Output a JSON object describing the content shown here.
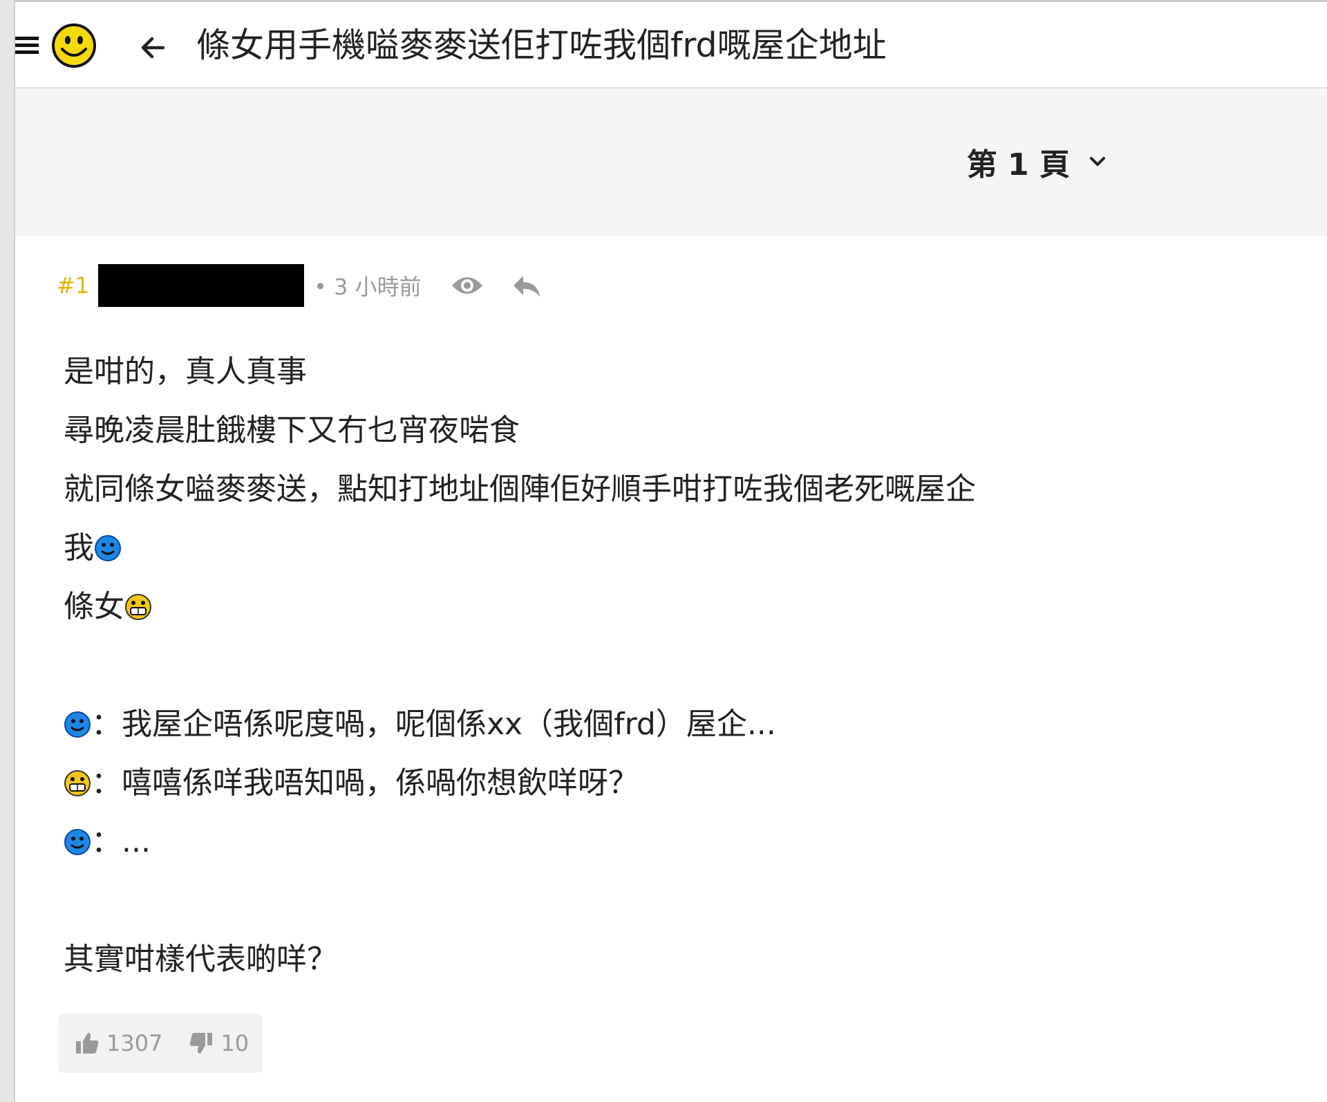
{
  "header": {
    "title": "條女用手機嗌麥麥送佢打咗我個frd嘅屋企地址"
  },
  "pagination": {
    "label": "第 1 頁"
  },
  "post": {
    "number": "#1",
    "time": "• 3 小時前",
    "lines": {
      "l1": "是咁的，真人真事",
      "l2": "尋晚凌晨肚餓樓下又冇乜宵夜啱食",
      "l3": "就同條女嗌麥麥送，點知打地址個陣佢好順手咁打咗我個老死嘅屋企",
      "l4": "我",
      "l5": "條女",
      "l6": "：我屋企唔係呢度喎，呢個係xx（我個frd）屋企...",
      "l7": "：嘻嘻係咩我唔知喎，係喎你想飲咩呀？",
      "l8": "：...",
      "l9": "其實咁樣代表啲咩？"
    },
    "likes": "1307",
    "dislikes": "10"
  },
  "colors": {
    "accent": "#e8b200",
    "emoji_blue": "#1e88e5",
    "emoji_yellow": "#f5c518"
  }
}
